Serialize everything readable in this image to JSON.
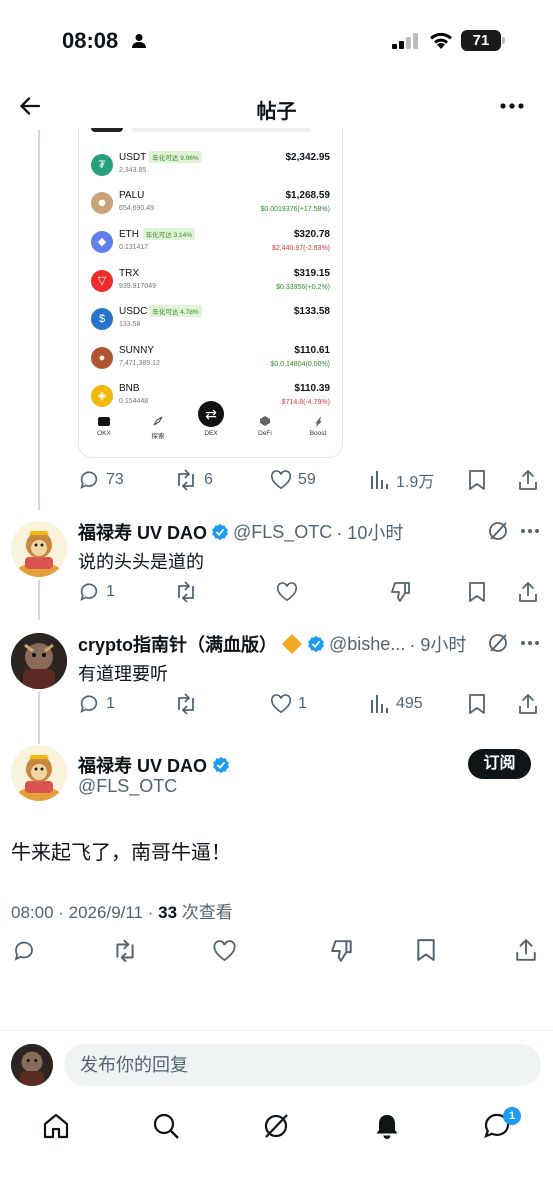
{
  "status_bar": {
    "time": "08:08",
    "battery": "71"
  },
  "header": {
    "title": "帖子"
  },
  "wallet": {
    "coins": [
      {
        "name": "USDT",
        "badge": "年化可达 9.96%",
        "amount": "2,343.85",
        "value": "$2,342.95",
        "change": "",
        "change_color": "#2e8b2e",
        "icon_color": "#26a17b",
        "icon_glyph": "₮"
      },
      {
        "name": "PALU",
        "badge": "",
        "amount": "654,690.49",
        "value": "$1,268.59",
        "change": "$0.0019376(+17.58%)",
        "change_color": "#2e8b2e",
        "icon_color": "#caa27a",
        "icon_glyph": "☻"
      },
      {
        "name": "ETH",
        "badge": "年化可达 3.14%",
        "amount": "0.131417",
        "value": "$320.78",
        "change": "$2,440.97(-2.63%)",
        "change_color": "#d63b3b",
        "icon_color": "#627eea",
        "icon_glyph": "◆"
      },
      {
        "name": "TRX",
        "badge": "",
        "amount": "939.917049",
        "value": "$319.15",
        "change": "$0.33956(+0.2%)",
        "change_color": "#2e8b2e",
        "icon_color": "#ef2c2c",
        "icon_glyph": "▽"
      },
      {
        "name": "USDC",
        "badge": "年化可达 4.78%",
        "amount": "133.58",
        "value": "$133.58",
        "change": "",
        "change_color": "#2e8b2e",
        "icon_color": "#2775ca",
        "icon_glyph": "$"
      },
      {
        "name": "SUNNY",
        "badge": "",
        "amount": "7,471,389.12",
        "value": "$110.61",
        "change": "$0.0,14804(0.00%)",
        "change_color": "#2e8b2e",
        "icon_color": "#b0552f",
        "icon_glyph": "●"
      },
      {
        "name": "BNB",
        "badge": "",
        "amount": "0.154448",
        "value": "$110.39",
        "change": "$714.8(-4.79%)",
        "change_color": "#d63b3b",
        "icon_color": "#f0b90b",
        "icon_glyph": "◈"
      }
    ],
    "nav": [
      "OKX",
      "探索",
      "DEX",
      "DeFi",
      "Boost"
    ]
  },
  "main_stats": {
    "replies": "73",
    "reposts": "6",
    "likes": "59",
    "views": "1.9万"
  },
  "reply1": {
    "name": "福禄寿 UV DAO",
    "handle": "@FLS_OTC",
    "time": "· 10小时",
    "text": "说的头头是道的",
    "replies": "1"
  },
  "reply2": {
    "name": "crypto指南针（满血版）",
    "handle": "@bishe...",
    "time": "· 9小时",
    "text": "有道理要听",
    "replies": "1",
    "likes": "1",
    "views": "495"
  },
  "post": {
    "name": "福禄寿 UV DAO",
    "handle": "@FLS_OTC",
    "subscribe": "订阅",
    "text": "牛来起飞了，南哥牛逼！",
    "time": "08:00 · 2026/9/11 · ",
    "views_count": "33",
    "views_label": " 次查看"
  },
  "reply_bar": {
    "placeholder": "发布你的回复"
  },
  "tabbar": {
    "messages_badge": "1"
  }
}
